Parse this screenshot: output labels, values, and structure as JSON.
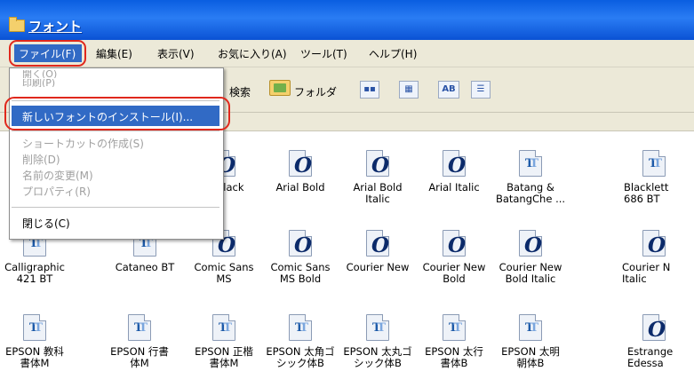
{
  "window": {
    "title": "フォント"
  },
  "menubar": {
    "items": [
      "ファイル(F)",
      "編集(E)",
      "表示(V)",
      "お気に入り(A)",
      "ツール(T)",
      "ヘルプ(H)"
    ]
  },
  "toolbar": {
    "search_label": "検索",
    "folder_label": "フォルダ",
    "view_buttons": [
      "list",
      "small-icons",
      "AB",
      "details"
    ]
  },
  "file_menu": {
    "partial_top_1": "開く(O)",
    "partial_top_2": "印刷(P)",
    "install": "新しいフォントのインストール(I)...",
    "create_shortcut": "ショートカットの作成(S)",
    "delete": "削除(D)",
    "rename": "名前の変更(M)",
    "properties": "プロパティ(R)",
    "close": "閉じる(C)"
  },
  "fonts": [
    {
      "label": "al Black",
      "icon": "opentype-icon"
    },
    {
      "label": "Arial Bold",
      "icon": "opentype-icon"
    },
    {
      "label": "Arial Bold\nItalic",
      "icon": "opentype-icon"
    },
    {
      "label": "Arial Italic",
      "icon": "opentype-icon"
    },
    {
      "label": "Batang &\nBatangChe ...",
      "icon": "truetype-icon"
    },
    {
      "label": "Blacklett\n686 BT",
      "icon": "truetype-icon"
    },
    {
      "label": "Calligraphic\n421 BT",
      "icon": "truetype-icon"
    },
    {
      "label": "Cataneo BT",
      "icon": "truetype-icon"
    },
    {
      "label": "Comic Sans\nMS",
      "icon": "opentype-icon"
    },
    {
      "label": "Comic Sans\nMS Bold",
      "icon": "opentype-icon"
    },
    {
      "label": "Courier New",
      "icon": "opentype-icon"
    },
    {
      "label": "Courier New\nBold",
      "icon": "opentype-icon"
    },
    {
      "label": "Courier New\nBold Italic",
      "icon": "opentype-icon"
    },
    {
      "label": "Courier N\nItalic",
      "icon": "opentype-icon"
    },
    {
      "label": "EPSON 教科\n書体M",
      "icon": "truetype-icon"
    },
    {
      "label": "EPSON 行書\n体M",
      "icon": "truetype-icon"
    },
    {
      "label": "EPSON 正楷\n書体M",
      "icon": "truetype-icon"
    },
    {
      "label": "EPSON 太角ゴ\nシック体B",
      "icon": "truetype-icon"
    },
    {
      "label": "EPSON 太丸ゴ\nシック体B",
      "icon": "truetype-icon"
    },
    {
      "label": "EPSON 太行\n書体B",
      "icon": "truetype-icon"
    },
    {
      "label": "EPSON 太明\n朝体B",
      "icon": "truetype-icon"
    },
    {
      "label": "Estrange\nEdessa",
      "icon": "opentype-icon"
    }
  ],
  "colors": {
    "highlight": "#316ac5",
    "callout": "#e0281c",
    "titlebar": "#0a5ee0"
  }
}
